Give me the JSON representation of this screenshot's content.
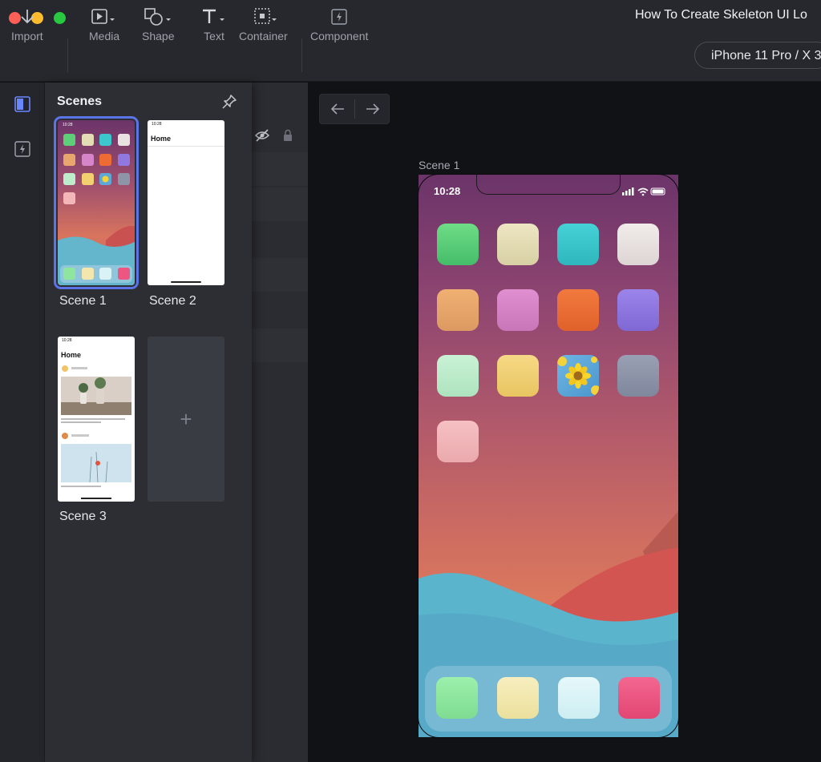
{
  "window": {
    "title": "How To Create Skeleton UI Lo"
  },
  "toolbar": {
    "import": "Import",
    "media": "Media",
    "shape": "Shape",
    "text": "Text",
    "container": "Container",
    "component": "Component",
    "device": "iPhone 11 Pro / X  3"
  },
  "scenes_panel": {
    "title": "Scenes",
    "scenes": [
      {
        "label": "Scene 1"
      },
      {
        "label": "Scene 2",
        "header": "Home",
        "time": "10:28"
      },
      {
        "label": "Scene 3",
        "header": "Home",
        "time": "10:28"
      }
    ],
    "add_symbol": "+"
  },
  "canvas": {
    "scene_label": "Scene 1",
    "status_time": "10:28"
  },
  "colors": {
    "accent": "#5b74e8",
    "app_icons": [
      "#5ccf78",
      "#e3dcb4",
      "#3cc7cc",
      "#e8e2e0",
      "#e8a66c",
      "#d585c8",
      "#ee6c34",
      "#8f78e0",
      "#bdeccb",
      "#f2d070",
      "#5ea8d8",
      "#8e95a8",
      "#f3b7ba"
    ],
    "dock_icons": [
      "#8ee69e",
      "#f3e7ad",
      "#d8f2f5",
      "#ed5680"
    ]
  }
}
